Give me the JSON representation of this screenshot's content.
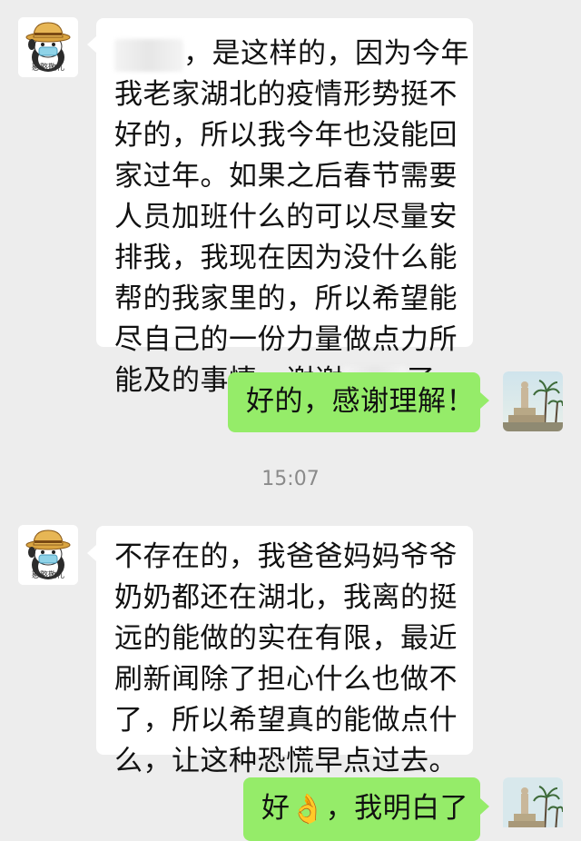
{
  "messages": [
    {
      "side": "incoming",
      "avatar_caption": "憨憨敬礼",
      "lines": [
        "，是这样的，因为今年",
        "我老家湖北的疫情形势挺不",
        "好的，所以我今年也没能回",
        "家过年。如果之后春节需要",
        "人员加班什么的可以尽量安",
        "排我，我现在因为没什么能",
        "帮的我家里的，所以希望能",
        "尽自己的一份力量做点力所",
        "能及的事情，谢谢",
        "了。"
      ]
    },
    {
      "side": "outgoing",
      "text": "好的，感谢理解！"
    },
    {
      "side": "timestamp",
      "text": "15:07"
    },
    {
      "side": "incoming",
      "avatar_caption": "憨憨敬礼",
      "lines": [
        "不存在的，我爸爸妈妈爷爷",
        "奶奶都还在湖北，我离的挺",
        "远的能做的实在有限，最近",
        "刷新闻除了担心什么也做不",
        "了，所以希望真的能做点什",
        "么，让这种恐慌早点过去。"
      ]
    },
    {
      "side": "outgoing",
      "text_before": "好",
      "emoji": "👌",
      "text_after": "，我明白了"
    }
  ],
  "colors": {
    "background": "#ededed",
    "incoming_bubble": "#ffffff",
    "outgoing_bubble": "#95ec69",
    "timestamp": "#8a8a8a"
  },
  "icons": {
    "incoming_avatar": "penguin-safari-hat-sticker",
    "outgoing_avatar": "monument-landscape-photo",
    "emoji": "ok-hand-emoji"
  }
}
